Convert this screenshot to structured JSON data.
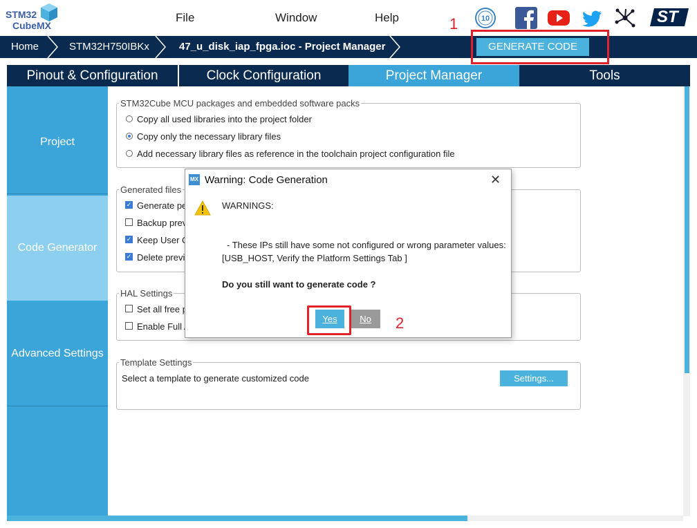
{
  "app": {
    "logo_line1": "STM32",
    "logo_line2": "CubeMX"
  },
  "menu": {
    "file": "File",
    "window": "Window",
    "help": "Help"
  },
  "social": {
    "icons": [
      "anniversary-10-icon",
      "facebook-icon",
      "youtube-icon",
      "twitter-icon",
      "network-icon",
      "st-logo-icon"
    ],
    "st_text": "ST"
  },
  "breadcrumb": {
    "home": "Home",
    "mcu": "STM32H750IBKx",
    "project": "47_u_disk_iap_fpga.ioc - Project Manager"
  },
  "toolbar": {
    "generate_label": "GENERATE CODE"
  },
  "annotations": {
    "step1": "1",
    "step2": "2"
  },
  "tabs": {
    "pinout": "Pinout & Configuration",
    "clock": "Clock Configuration",
    "project_manager": "Project Manager",
    "tools": "Tools"
  },
  "sidebar": {
    "project": "Project",
    "code_generator": "Code Generator",
    "advanced": "Advanced Settings"
  },
  "packs": {
    "title": "STM32Cube MCU packages and embedded software packs",
    "opt1": "Copy all used libraries into the project folder",
    "opt2": "Copy only the necessary library files",
    "opt3": "Add necessary library files as reference in the toolchain project configuration file"
  },
  "generated": {
    "title": "Generated files",
    "opt1": "Generate pe",
    "opt2": "Backup prev",
    "opt3": "Keep User C",
    "opt4": "Delete previ"
  },
  "hal": {
    "title": "HAL Settings",
    "opt1": "Set all free p",
    "opt2": "Enable Full A"
  },
  "template": {
    "title": "Template Settings",
    "desc": "Select a template to generate customized code",
    "button": "Settings..."
  },
  "dialog": {
    "icon": "MX",
    "title": "Warning: Code Generation",
    "close": "✕",
    "warnings": "WARNINGS:",
    "line1": "- These IPs still have some not configured or wrong parameter values:",
    "line2": "[USB_HOST, Verify the Platform Settings Tab ]",
    "question": "Do you still want to generate code ?",
    "yes": "Yes",
    "no": "No"
  },
  "colors": {
    "navy": "#0b2a4f",
    "accent": "#4bb2de",
    "sidebar": "#3ba4d8",
    "sidebar_active": "#8ccfee",
    "annotation": "#e0202a"
  }
}
